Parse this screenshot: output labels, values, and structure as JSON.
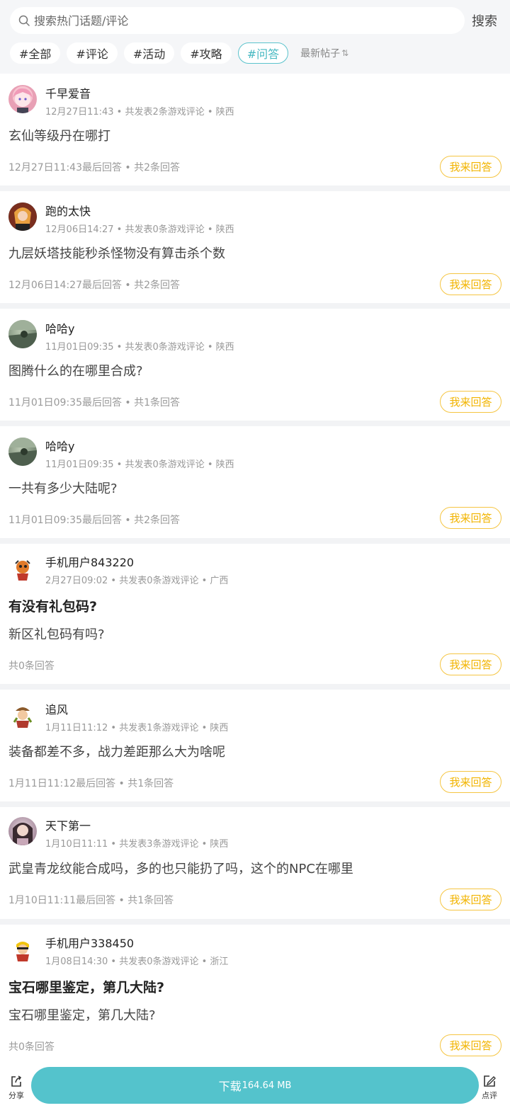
{
  "search": {
    "placeholder": "搜索热门话题/评论",
    "button_label": "搜索"
  },
  "tags": [
    {
      "label": "#全部"
    },
    {
      "label": "#评论"
    },
    {
      "label": "#活动"
    },
    {
      "label": "#攻略"
    },
    {
      "label": "#问答",
      "active": true
    }
  ],
  "sort_label": "最新帖子",
  "sort_icon": "⇅",
  "answer_label": "我来回答",
  "posts": [
    {
      "user": "千早爱音",
      "meta": "12月27日11:43 • 共发表2条游戏评论 • 陕西",
      "content": "玄仙等级丹在哪打",
      "footer": "12月27日11:43最后回答 • 共2条回答"
    },
    {
      "user": "跑的太快",
      "meta": "12月06日14:27 • 共发表0条游戏评论 • 陕西",
      "content": "九层妖塔技能秒杀怪物没有算击杀个数",
      "footer": "12月06日14:27最后回答 • 共2条回答"
    },
    {
      "user": "哈哈y",
      "meta": "11月01日09:35 • 共发表0条游戏评论 • 陕西",
      "content": "图腾什么的在哪里合成?",
      "footer": "11月01日09:35最后回答 • 共1条回答"
    },
    {
      "user": "哈哈y",
      "meta": "11月01日09:35 • 共发表0条游戏评论 • 陕西",
      "content": "一共有多少大陆呢?",
      "footer": "11月01日09:35最后回答 • 共2条回答"
    },
    {
      "user": "手机用户843220",
      "meta": "2月27日09:02 • 共发表0条游戏评论 • 广西",
      "title": "有没有礼包码?",
      "content": "新区礼包码有吗?",
      "footer": "共0条回答"
    },
    {
      "user": "追风",
      "meta": "1月11日11:12 • 共发表1条游戏评论 • 陕西",
      "content": "装备都差不多，战力差距那么大为啥呢",
      "footer": "1月11日11:12最后回答 • 共1条回答"
    },
    {
      "user": "天下第一",
      "meta": "1月10日11:11 • 共发表3条游戏评论 • 陕西",
      "content": "武皇青龙纹能合成吗，多的也只能扔了吗，这个的NPC在哪里",
      "footer": "1月10日11:11最后回答 • 共1条回答"
    },
    {
      "user": "手机用户338450",
      "meta": "1月08日14:30 • 共发表0条游戏评论 • 浙江",
      "title": "宝石哪里鉴定，第几大陆?",
      "content": "宝石哪里鉴定，第几大陆?",
      "footer": "共0条回答"
    }
  ],
  "bottom": {
    "share_label": "分享",
    "download_label": "下载",
    "download_size": "164.64 MB",
    "review_label": "点评"
  },
  "colors": {
    "accent": "#54c3cc",
    "answer": "#f2b400",
    "background": "#f2f3f5"
  }
}
